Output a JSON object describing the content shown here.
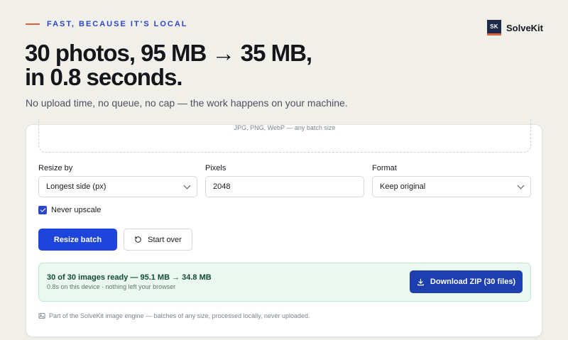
{
  "eyebrow": "FAST, BECAUSE IT'S LOCAL",
  "brand": {
    "logo_text": "SK",
    "name": "SolveKit"
  },
  "headline": {
    "line1": "30 photos, 95 MB → 35 MB,",
    "line2": "in 0.8 seconds."
  },
  "subhead": "No upload time, no queue, no cap — the work happens on your machine.",
  "dropzone": {
    "hint": "JPG, PNG, WebP — any batch size"
  },
  "form": {
    "resize_by": {
      "label": "Resize by",
      "value": "Longest side (px)"
    },
    "pixels": {
      "label": "Pixels",
      "value": "2048"
    },
    "format": {
      "label": "Format",
      "value": "Keep original"
    },
    "never_upscale": {
      "label": "Never upscale",
      "checked": true
    }
  },
  "actions": {
    "primary": "Resize batch",
    "secondary": "Start over"
  },
  "result": {
    "title": "30 of 30 images ready — 95.1 MB → 34.8 MB",
    "subtitle": "0.8s on this device · nothing left your browser",
    "download": "Download ZIP (30 files)"
  },
  "footnote": "Part of the SolveKit image engine — batches of any size, processed locally, never uploaded.",
  "colors": {
    "accent_blue": "#1d45db",
    "eyebrow_blue": "#2a47c9",
    "eyebrow_rule": "#e0603a",
    "success_bg": "#eaf8f1",
    "page_bg": "#f1efe9"
  },
  "icons": {
    "brand": "solvekit-logo",
    "select_chevron": "chevron-down-icon",
    "start_over": "refresh-icon",
    "download": "download-icon",
    "footnote": "image-icon"
  }
}
